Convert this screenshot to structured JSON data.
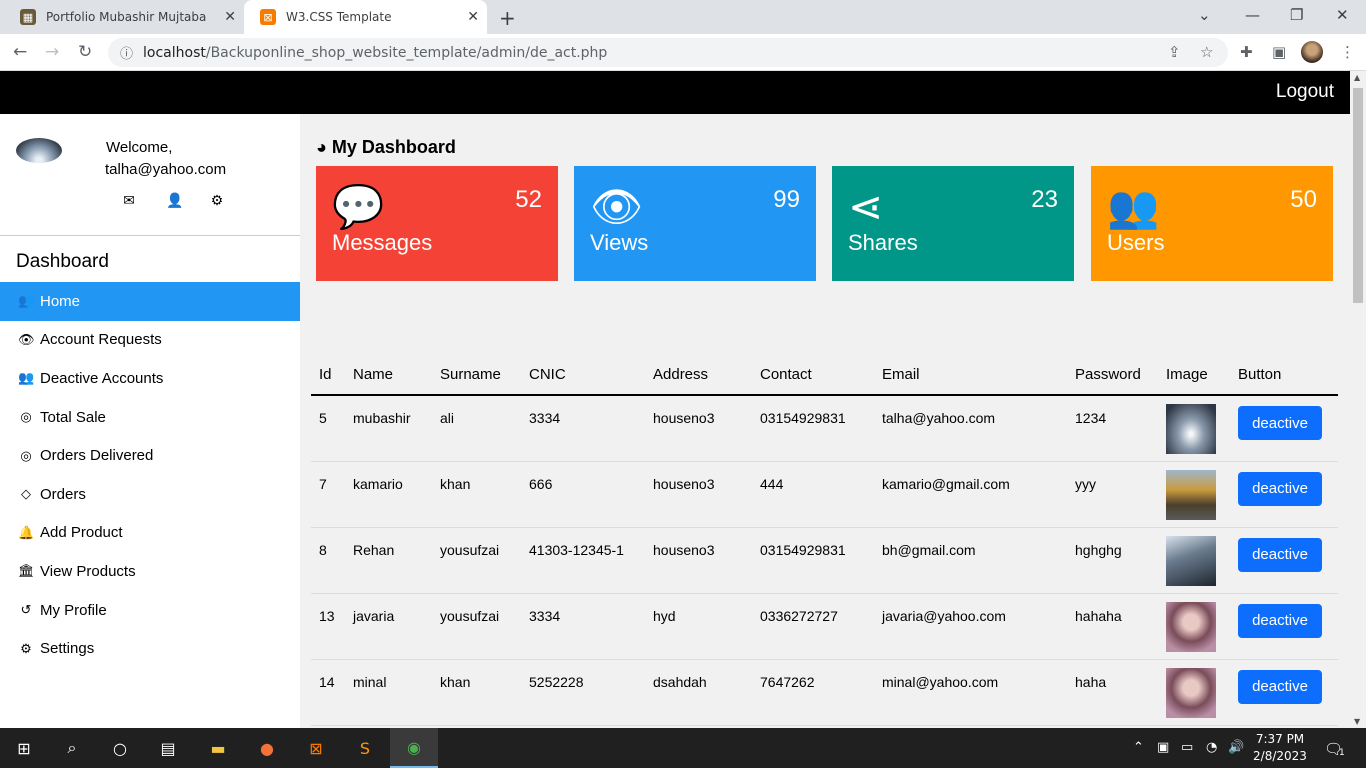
{
  "browser": {
    "tabs": [
      {
        "title": "Portfolio Mubashir Mujtaba",
        "active": false
      },
      {
        "title": "W3.CSS Template",
        "active": true
      }
    ],
    "url_host": "localhost",
    "url_path": "/Backuponline_shop_website_template/admin/de_act.php"
  },
  "topbar": {
    "logout": "Logout"
  },
  "sidebar": {
    "welcome": "Welcome,",
    "email": "talha@yahoo.com",
    "dashboard_title": "Dashboard",
    "menu": [
      {
        "label": "Home",
        "icon": "users-icon",
        "glyph": "👥",
        "active": true
      },
      {
        "label": "Account Requests",
        "icon": "eye-icon",
        "glyph": "👁",
        "active": false
      },
      {
        "label": "Deactive Accounts",
        "icon": "users-icon",
        "glyph": "👥",
        "active": false
      },
      {
        "label": "Total Sale",
        "icon": "bullseye-icon",
        "glyph": "◎",
        "active": false
      },
      {
        "label": "Orders Delivered",
        "icon": "bullseye-icon",
        "glyph": "◎",
        "active": false
      },
      {
        "label": "Orders",
        "icon": "diamond-icon",
        "glyph": "◇",
        "active": false
      },
      {
        "label": "Add Product",
        "icon": "bell-icon",
        "glyph": "🔔",
        "active": false
      },
      {
        "label": "View Products",
        "icon": "bank-icon",
        "glyph": "🏛",
        "active": false
      },
      {
        "label": "My Profile",
        "icon": "history-icon",
        "glyph": "↺",
        "active": false
      },
      {
        "label": "Settings",
        "icon": "cog-icon",
        "glyph": "⚙",
        "active": false
      }
    ]
  },
  "main": {
    "title": "My Dashboard",
    "cards": [
      {
        "label": "Messages",
        "value": "52",
        "color": "#f44336",
        "icon": "comment-icon"
      },
      {
        "label": "Views",
        "value": "99",
        "color": "#2196F3",
        "icon": "eye-icon"
      },
      {
        "label": "Shares",
        "value": "23",
        "color": "#009688",
        "icon": "share-icon"
      },
      {
        "label": "Users",
        "value": "50",
        "color": "#ff9800",
        "icon": "users-icon"
      }
    ],
    "table": {
      "headers": [
        "Id",
        "Name",
        "Surname",
        "CNIC",
        "Address",
        "Contact",
        "Email",
        "Password",
        "Image",
        "Button"
      ],
      "rows": [
        {
          "id": "5",
          "name": "mubashir",
          "surname": "ali",
          "cnic": "3334",
          "address": "houseno3",
          "contact": "03154929831",
          "email": "talha@yahoo.com",
          "password": "1234",
          "button": "deactive"
        },
        {
          "id": "7",
          "name": "kamario",
          "surname": "khan",
          "cnic": "666",
          "address": "houseno3",
          "contact": "444",
          "email": "kamario@gmail.com",
          "password": "yyy",
          "button": "deactive"
        },
        {
          "id": "8",
          "name": "Rehan",
          "surname": "yousufzai",
          "cnic": "41303-12345-1",
          "address": "houseno3",
          "contact": "03154929831",
          "email": "bh@gmail.com",
          "password": "hghghg",
          "button": "deactive"
        },
        {
          "id": "13",
          "name": "javaria",
          "surname": "yousufzai",
          "cnic": "3334",
          "address": "hyd",
          "contact": "0336272727",
          "email": "javaria@yahoo.com",
          "password": "hahaha",
          "button": "deactive"
        },
        {
          "id": "14",
          "name": "minal",
          "surname": "khan",
          "cnic": "5252228",
          "address": "dsahdah",
          "contact": "7647262",
          "email": "minal@yahoo.com",
          "password": "haha",
          "button": "deactive"
        }
      ]
    }
  },
  "taskbar": {
    "time": "7:37 PM",
    "date": "2/8/2023",
    "notification_count": "1"
  }
}
